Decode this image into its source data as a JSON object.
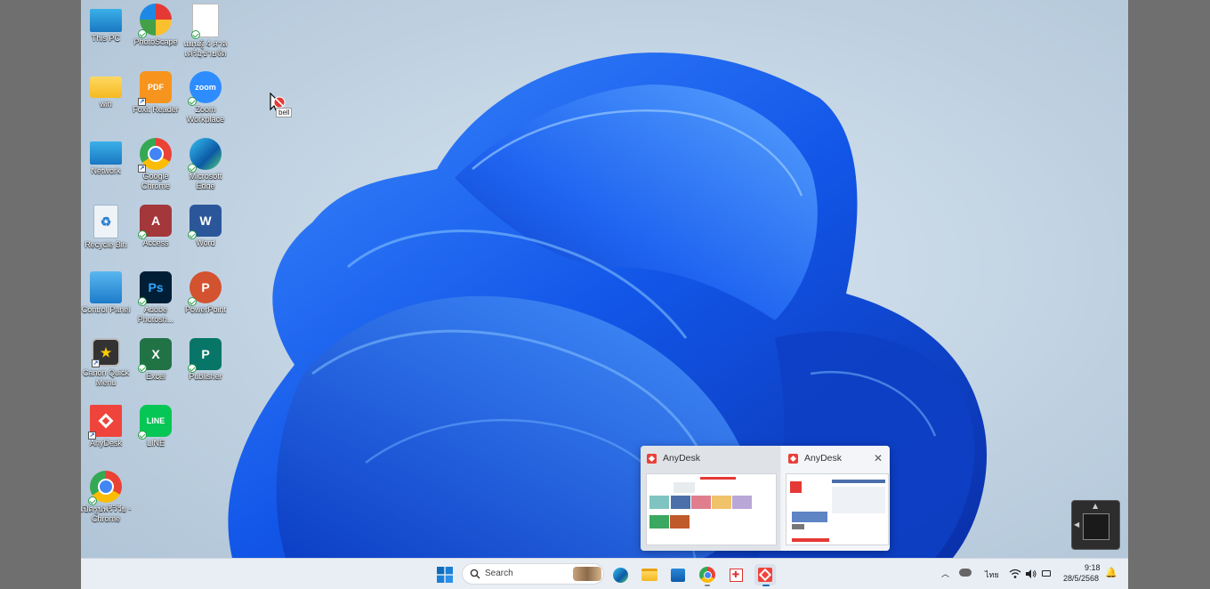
{
  "desktop": {
    "icons": [
      {
        "label": "This PC"
      },
      {
        "label": "PhotoScape"
      },
      {
        "label": "แผนผู้ 4 ศาล เครือข่ายจัดเรีย..."
      },
      {
        "label": "win"
      },
      {
        "label": "Foxit Reader"
      },
      {
        "label": "Zoom Workplace"
      },
      {
        "label": "Network"
      },
      {
        "label": "Google Chrome"
      },
      {
        "label": "Microsoft Edge"
      },
      {
        "label": "Recycle Bin"
      },
      {
        "label": "Access"
      },
      {
        "label": "Word"
      },
      {
        "label": "Control Panel"
      },
      {
        "label": "Adobe Photosh..."
      },
      {
        "label": "PowerPoint"
      },
      {
        "label": "Canon Quick Menu"
      },
      {
        "label": "Excel"
      },
      {
        "label": "Publisher"
      },
      {
        "label": "AnyDesk"
      },
      {
        "label": "LINE"
      },
      {
        "label": "เปิดรูปพรีวิวีย - Chrome"
      }
    ],
    "cursor_tooltip": "bell"
  },
  "preview": {
    "windows": [
      {
        "title": "AnyDesk"
      },
      {
        "title": "AnyDesk"
      }
    ]
  },
  "taskbar": {
    "search_placeholder": "Search",
    "language": "ไทย",
    "time": "9:18",
    "date": "28/5/2568"
  },
  "colors": {
    "taskbar_bg": "#e9eef5",
    "anydesk_red": "#e8403a",
    "accent_blue": "#0f6cbd"
  }
}
